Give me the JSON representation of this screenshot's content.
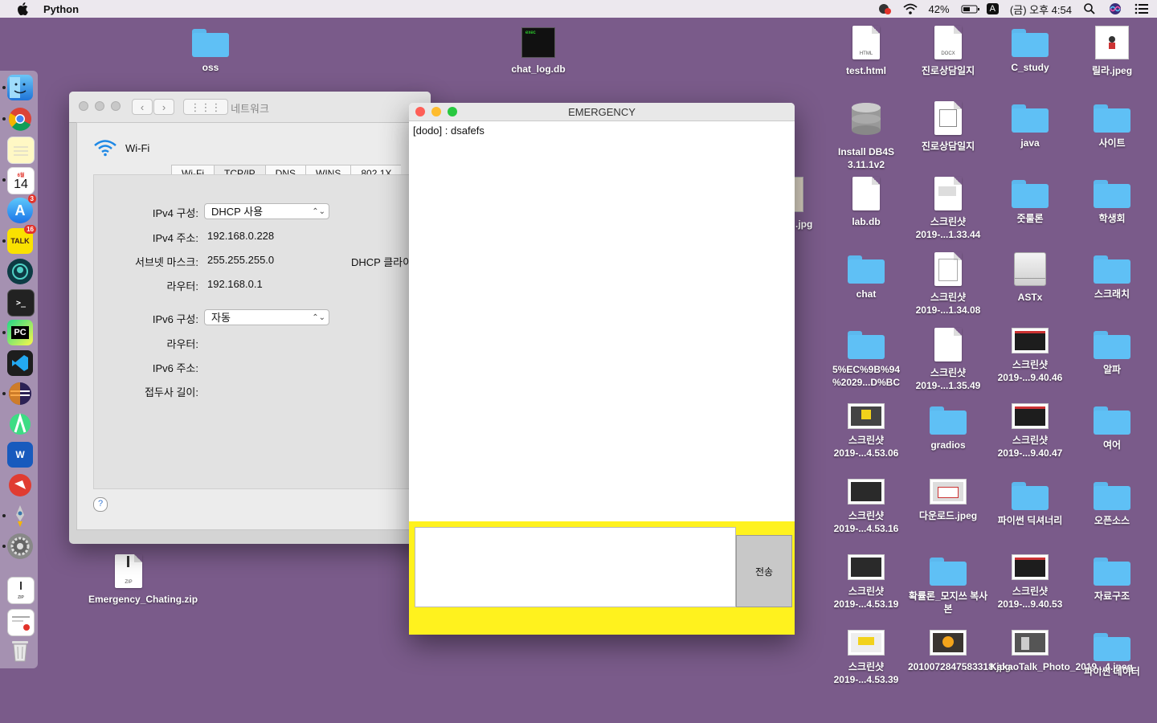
{
  "menubar": {
    "app_name": "Python",
    "battery": "42%",
    "input_source": "A",
    "clock": "(금) 오후 4:54"
  },
  "dock": {
    "calendar_day": "14",
    "calendar_month": "6월",
    "appstore_badge": "3",
    "talk_badge": "16"
  },
  "desktop": {
    "left_icons": [
      {
        "label": "oss"
      },
      {
        "label": "chat_log.db"
      },
      {
        "label": "Emergency_Chating.zip"
      }
    ],
    "grid": [
      {
        "label": "test.html"
      },
      {
        "label": "진로상담일지"
      },
      {
        "label": "C_study"
      },
      {
        "label": "릴라.jpeg"
      },
      {
        "label": "Install DB4S 3.11.1v2"
      },
      {
        "label": "진로상담일지"
      },
      {
        "label": "java"
      },
      {
        "label": "사이트"
      },
      {
        "label": "lab.db"
      },
      {
        "label": "스크린샷 2019-...1.33.44"
      },
      {
        "label": "줏룰론"
      },
      {
        "label": "학생회"
      },
      {
        "label": "chat"
      },
      {
        "label": "스크린샷 2019-...1.34.08"
      },
      {
        "label": "ASTx"
      },
      {
        "label": "스크래치"
      },
      {
        "label": "5%EC%9B%94 %2029...D%BC"
      },
      {
        "label": "스크린샷 2019-...1.35.49"
      },
      {
        "label": "스크린샷 2019-...9.40.46"
      },
      {
        "label": "알파"
      },
      {
        "label": "스크린샷 2019-...4.53.06"
      },
      {
        "label": "gradios"
      },
      {
        "label": "스크린샷 2019-...9.40.47"
      },
      {
        "label": "여어"
      },
      {
        "label": "스크린샷 2019-...4.53.16"
      },
      {
        "label": "다운로드.jpeg"
      },
      {
        "label": "파이썬 딕셔너리"
      },
      {
        "label": "오픈소스"
      },
      {
        "label": "스크린샷 2019-...4.53.19"
      },
      {
        "label": "확률론_모지쓰 복사본"
      },
      {
        "label": "스크린샷 2019-...9.40.53"
      },
      {
        "label": "자료구조"
      },
      {
        "label": "스크린샷 2019-...4.53.39"
      },
      {
        "label": "2010072847583318.jpg"
      },
      {
        "label": "KakaoTalk_Photo_2019...4.jpeg"
      },
      {
        "label": "파이썬 데이터"
      }
    ],
    "partial_label": ".jpg"
  },
  "network": {
    "title": "네트워크",
    "service": "Wi-Fi",
    "tabs": [
      "Wi-Fi",
      "TCP/IP",
      "DNS",
      "WINS",
      "802.1X"
    ],
    "ipv4_config_label": "IPv4 구성:",
    "ipv4_config_value": "DHCP 사용",
    "ipv4_addr_label": "IPv4 주소:",
    "ipv4_addr_value": "192.168.0.228",
    "subnet_label": "서브넷 마스크:",
    "subnet_value": "255.255.255.0",
    "dhcp_client_label": "DHCP 클라이",
    "router_label": "라우터:",
    "router_value": "192.168.0.1",
    "ipv6_config_label": "IPv6 구성:",
    "ipv6_config_value": "자동",
    "ipv6_router_label": "라우터:",
    "ipv6_addr_label": "IPv6 주소:",
    "prefix_label": "접두사 길이:",
    "help": "?"
  },
  "emergency": {
    "title": "EMERGENCY",
    "messages": [
      "[dodo] : dsafefs"
    ],
    "send_label": "전송"
  }
}
